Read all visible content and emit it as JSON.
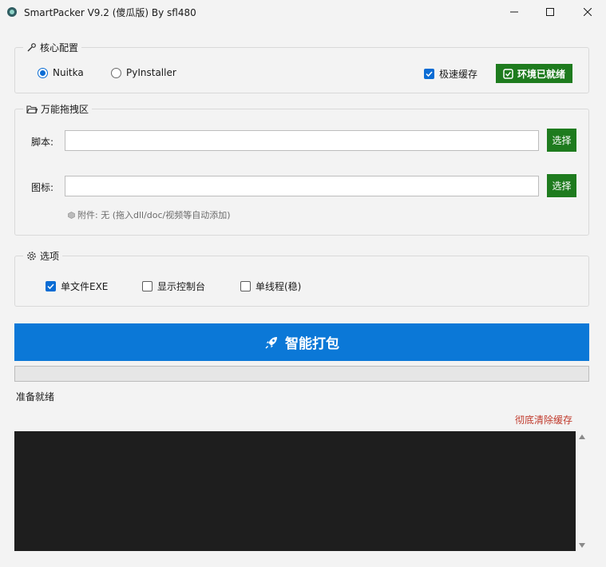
{
  "window": {
    "title": "SmartPacker V9.2 (傻瓜版) By sfl480"
  },
  "core": {
    "title": "核心配置",
    "options": [
      {
        "label": "Nuitka",
        "selected": true
      },
      {
        "label": "PyInstaller",
        "selected": false
      }
    ],
    "fast_cache": {
      "label": "极速缓存",
      "checked": true
    },
    "env_status": "环境已就绪"
  },
  "drop": {
    "title": "万能拖拽区",
    "script": {
      "label": "脚本:",
      "value": "",
      "button": "选择"
    },
    "icon": {
      "label": "图标:",
      "value": "",
      "button": "选择"
    },
    "note": "附件: 无 (拖入dll/doc/视频等自动添加)"
  },
  "options": {
    "title": "选项",
    "items": [
      {
        "label": "单文件EXE",
        "checked": true
      },
      {
        "label": "显示控制台",
        "checked": false
      },
      {
        "label": "单线程(稳)",
        "checked": false
      }
    ]
  },
  "actions": {
    "pack_label": "智能打包",
    "progress": 0,
    "status": "准备就绪",
    "clear_cache": "彻底清除缓存"
  },
  "colors": {
    "accent": "#0b78d7",
    "green": "#1e7b1e",
    "danger": "#c0392b",
    "console_bg": "#1e1e1e"
  }
}
